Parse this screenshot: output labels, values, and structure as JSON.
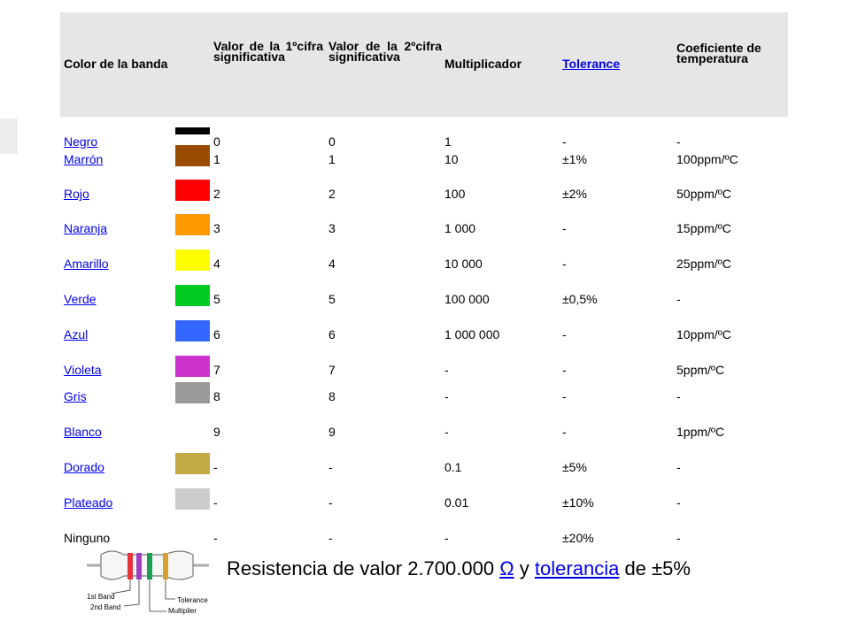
{
  "table": {
    "headers": {
      "color": "Color de la banda",
      "digit1": "Valor de la 1ºcifra significativa",
      "digit2": "Valor de la 2ºcifra significativa",
      "multiplier": "Multiplicador",
      "tolerance": "Tolerance",
      "tempco": "Coeficiente de temperatura"
    },
    "rows": [
      {
        "name": "Negro",
        "color": "#000000",
        "d1": "0",
        "d2": "0",
        "mult": "1",
        "tol": "-",
        "tc": "-"
      },
      {
        "name": "Marrón",
        "color": "#994c00",
        "d1": "1",
        "d2": "1",
        "mult": "10",
        "tol": "±1%",
        "tc": "100ppm/ºC"
      },
      {
        "name": "Rojo",
        "color": "#ff0000",
        "d1": "2",
        "d2": "2",
        "mult": "100",
        "tol": "±2%",
        "tc": "50ppm/ºC"
      },
      {
        "name": "Naranja",
        "color": "#ff9900",
        "d1": "3",
        "d2": "3",
        "mult": "1 000",
        "tol": "-",
        "tc": "15ppm/ºC"
      },
      {
        "name": "Amarillo",
        "color": "#ffff00",
        "d1": "4",
        "d2": "4",
        "mult": "10 000",
        "tol": "-",
        "tc": "25ppm/ºC"
      },
      {
        "name": "Verde",
        "color": "#00cc22",
        "d1": "5",
        "d2": "5",
        "mult": "100 000",
        "tol": "±0,5%",
        "tc": "-"
      },
      {
        "name": "Azul",
        "color": "#3366ff",
        "d1": "6",
        "d2": "6",
        "mult": "1 000 000",
        "tol": "-",
        "tc": "10ppm/ºC"
      },
      {
        "name": "Violeta",
        "color": "#cc33cc",
        "d1": "7",
        "d2": "7",
        "mult": "-",
        "tol": "-",
        "tc": "5ppm/ºC"
      },
      {
        "name": "Gris",
        "color": "#999999",
        "d1": "8",
        "d2": "8",
        "mult": "-",
        "tol": "-",
        "tc": "-"
      },
      {
        "name": "Blanco",
        "color": "#ffffff",
        "d1": "9",
        "d2": "9",
        "mult": "-",
        "tol": "-",
        "tc": "1ppm/ºC"
      },
      {
        "name": "Dorado",
        "color": "#c2aa44",
        "d1": "-",
        "d2": "-",
        "mult": "0.1",
        "tol": "±5%",
        "tc": "-"
      },
      {
        "name": "Plateado",
        "color": "#cccccc",
        "d1": "-",
        "d2": "-",
        "mult": "0.01",
        "tol": "±10%",
        "tc": "-"
      },
      {
        "name": "Ninguno",
        "color": "",
        "d1": "-",
        "d2": "-",
        "mult": "-",
        "tol": "±20%",
        "tc": "-"
      }
    ]
  },
  "diagram": {
    "labels": {
      "band1": "1st Band",
      "band2": "2nd Band",
      "tolerance": "Tolerance",
      "multiplier": "Multiplier"
    },
    "band_colors": [
      "#e8323c",
      "#a040c0",
      "#1aa050",
      "#d8a030"
    ]
  },
  "caption": {
    "text_before": "Resistencia de valor 2.700.000",
    "ohm_link": "Ω",
    "text_mid": "y",
    "tolerance_link": "tolerancia",
    "text_after": "de ±5%"
  },
  "colors": {
    "header_bg": "#e6e6e6",
    "link": "#0000ee"
  }
}
